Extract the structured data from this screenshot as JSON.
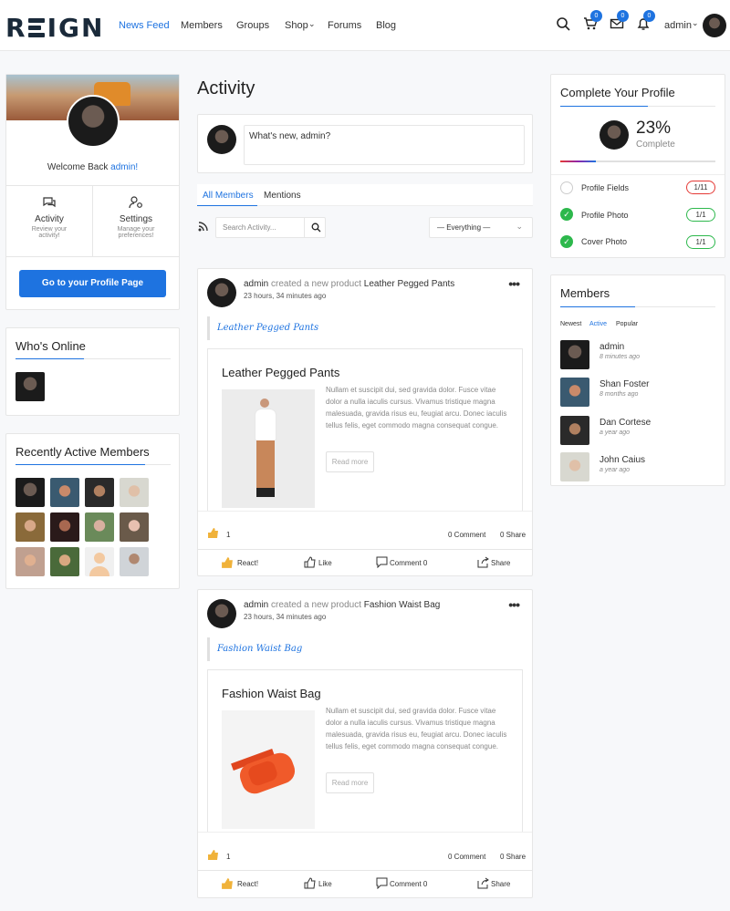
{
  "header": {
    "logo": "REIGN",
    "nav": [
      "News Feed",
      "Members",
      "Groups",
      "Shop",
      "Forums",
      "Blog"
    ],
    "cart_count": "0",
    "msg_count": "0",
    "notif_count": "0",
    "user": "admin"
  },
  "profile_card": {
    "welcome": "Welcome Back ",
    "username": "admin!",
    "activity": {
      "title": "Activity",
      "sub": "Review your activity!"
    },
    "settings": {
      "title": "Settings",
      "sub": "Manage your preferences!"
    },
    "button": "Go to your Profile Page"
  },
  "whos_online": {
    "title": "Who's Online"
  },
  "recent_members": {
    "title": "Recently Active Members"
  },
  "page_title": "Activity",
  "composer": {
    "placeholder": "What's new, admin?"
  },
  "tabs": [
    "All Members",
    "Mentions"
  ],
  "search": {
    "placeholder": "Search Activity..."
  },
  "filter": {
    "selected": "— Everything —"
  },
  "posts": [
    {
      "author": "admin",
      "action": "created a new product",
      "product": "Leather Pegged Pants",
      "time": "23 hours, 34 minutes ago",
      "quote": "Leather Pegged Pants",
      "desc": "Nullam et suscipit dui, sed gravida dolor. Fusce vitae dolor a nulla iaculis cursus. Vivamus tristique magna malesuada, gravida risus eu, feugiat arcu. Donec iaculis tellus felis, eget commodo magna consequat congue.",
      "read_more": "Read more",
      "likes": "1",
      "comments": "0 Comment",
      "shares": "0 Share"
    },
    {
      "author": "admin",
      "action": "created a new product",
      "product": "Fashion Waist Bag",
      "time": "23 hours, 34 minutes ago",
      "quote": "Fashion Waist Bag",
      "desc": "Nullam et suscipit dui, sed gravida dolor. Fusce vitae dolor a nulla iaculis cursus. Vivamus tristique magna malesuada, gravida risus eu, feugiat arcu. Donec iaculis tellus felis, eget commodo magna consequat congue.",
      "read_more": "Read more",
      "likes": "1",
      "comments": "0 Comment",
      "shares": "0 Share"
    }
  ],
  "post_actions": {
    "react": "React!",
    "like": "Like",
    "comment": "Comment 0",
    "share": "Share"
  },
  "complete_profile": {
    "title": "Complete Your Profile",
    "percent": "23%",
    "label": "Complete",
    "progress": 0.23,
    "items": [
      {
        "label": "Profile Fields",
        "value": "1/11",
        "done": false
      },
      {
        "label": "Profile Photo",
        "value": "1/1",
        "done": true
      },
      {
        "label": "Cover Photo",
        "value": "1/1",
        "done": true
      }
    ]
  },
  "members_widget": {
    "title": "Members",
    "filters": [
      "Newest",
      "Active",
      "Popular"
    ],
    "list": [
      {
        "name": "admin",
        "time": "8 minutes ago"
      },
      {
        "name": "Shan Foster",
        "time": "8 months ago"
      },
      {
        "name": "Dan Cortese",
        "time": "a year ago"
      },
      {
        "name": "John Caius",
        "time": "a year ago"
      }
    ]
  },
  "colors": {
    "accent": "#1e73e0",
    "success": "#2db84c",
    "danger": "#e53935"
  }
}
